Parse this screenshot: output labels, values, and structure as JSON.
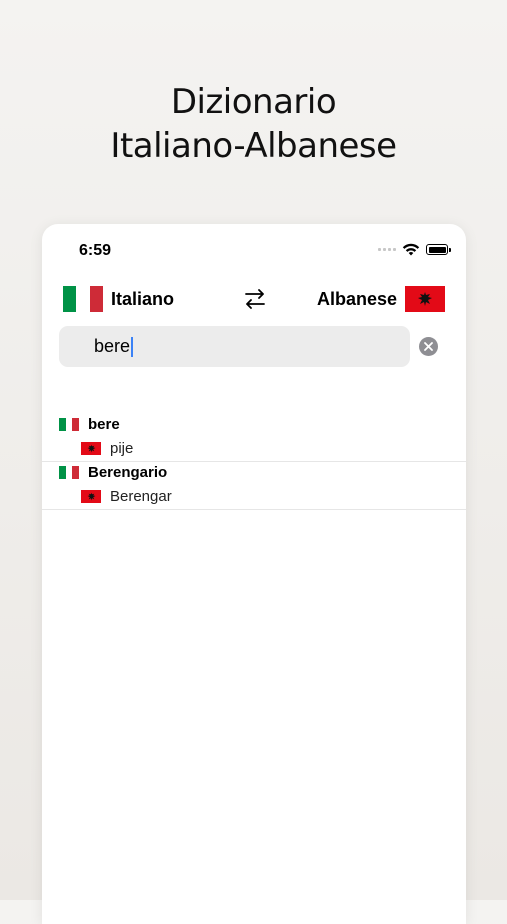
{
  "headline": {
    "line1": "Dizionario",
    "line2": "Italiano-Albanese"
  },
  "status_bar": {
    "time": "6:59"
  },
  "languages": {
    "from": "Italiano",
    "to": "Albanese"
  },
  "search": {
    "value": "bere"
  },
  "results": [
    {
      "term": "bere",
      "translation": "pije"
    },
    {
      "term": "Berengario",
      "translation": "Berengar"
    }
  ],
  "colors": {
    "italy_green": "#009246",
    "italy_white": "#ffffff",
    "italy_red": "#ce2b37",
    "albania_red": "#e30a17",
    "caret": "#3b82f6"
  },
  "icons": [
    "signal-icon",
    "wifi-icon",
    "battery-icon",
    "swap-icon",
    "clear-icon",
    "italy-flag-icon",
    "albania-flag-icon"
  ]
}
